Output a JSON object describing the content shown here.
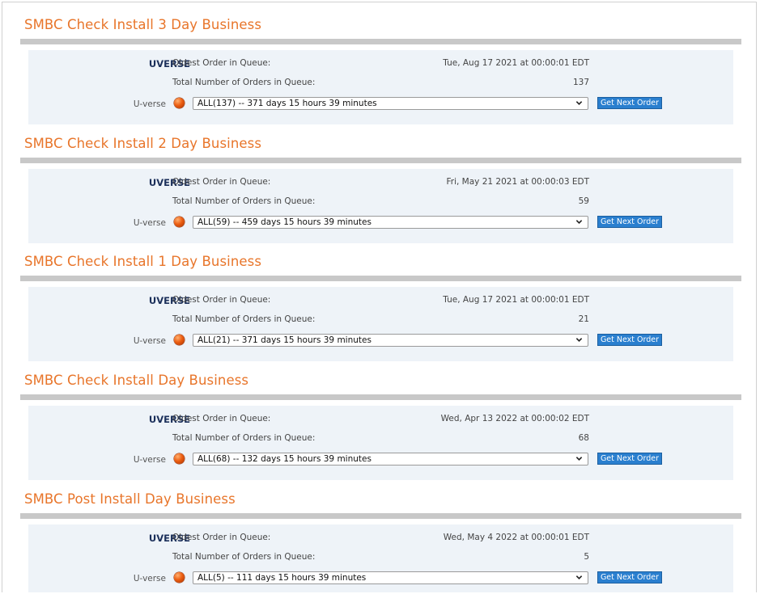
{
  "colors": {
    "section_title": "#e8752a",
    "panel_background": "#eef3f8",
    "rule": "#c8c8c8",
    "queue_name": "#1b2f5a",
    "button": "#2a7fcf"
  },
  "labels": {
    "queue_name": "UVERSE",
    "oldest_label": "Oldest Order in Queue:",
    "total_label": "Total Number of Orders in Queue:",
    "product_label": "U-verse",
    "button_label": "Get Next Order",
    "status_icon": "red-orb-icon"
  },
  "sections": [
    {
      "title": "SMBC Check Install 3 Day Business",
      "oldest": "Tue, Aug 17 2021 at 00:00:01 EDT",
      "total": "137",
      "selected": "ALL(137) -- 371 days 15 hours 39 minutes"
    },
    {
      "title": "SMBC Check Install 2 Day Business",
      "oldest": "Fri, May 21 2021 at 00:00:03 EDT",
      "total": "59",
      "selected": "ALL(59) -- 459 days 15 hours 39 minutes"
    },
    {
      "title": "SMBC Check Install 1 Day Business",
      "oldest": "Tue, Aug 17 2021 at 00:00:01 EDT",
      "total": "21",
      "selected": "ALL(21) -- 371 days 15 hours 39 minutes"
    },
    {
      "title": "SMBC Check Install Day Business",
      "oldest": "Wed, Apr 13 2022 at 00:00:02 EDT",
      "total": "68",
      "selected": "ALL(68) -- 132 days 15 hours 39 minutes"
    },
    {
      "title": "SMBC Post Install Day Business",
      "oldest": "Wed, May 4 2022 at 00:00:01 EDT",
      "total": "5",
      "selected": "ALL(5) -- 111 days 15 hours 39 minutes"
    }
  ]
}
